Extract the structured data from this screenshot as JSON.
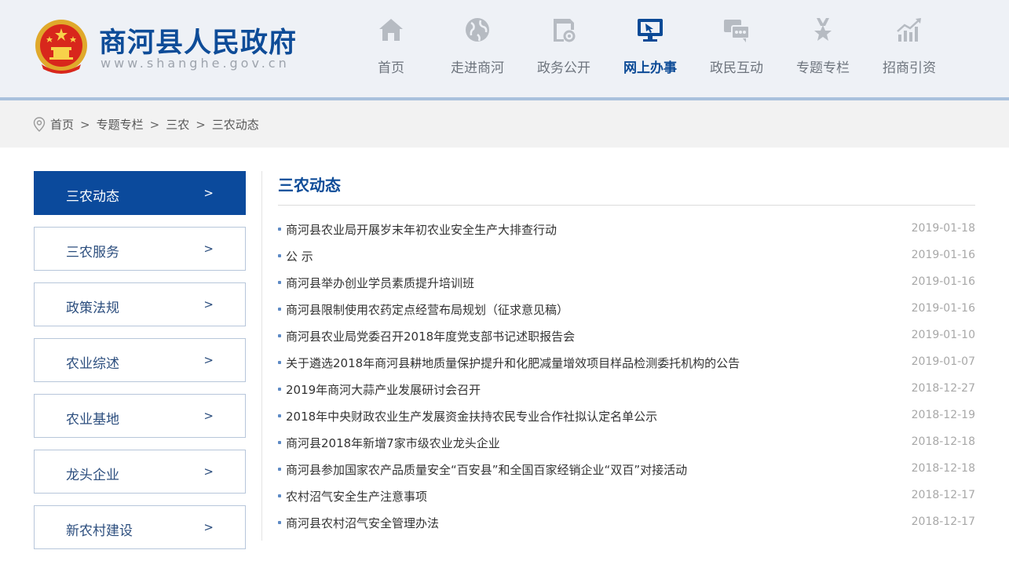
{
  "header": {
    "title": "商河县人民政府",
    "url": "www.shanghe.gov.cn",
    "emblem_icon": "national-emblem-icon"
  },
  "nav": {
    "items": [
      {
        "label": "首页",
        "icon": "home-icon"
      },
      {
        "label": "走进商河",
        "icon": "globe-icon"
      },
      {
        "label": "政务公开",
        "icon": "document-gear-icon"
      },
      {
        "label": "网上办事",
        "icon": "monitor-icon",
        "active": true
      },
      {
        "label": "政民互动",
        "icon": "chat-icon"
      },
      {
        "label": "专题专栏",
        "icon": "medal-icon"
      },
      {
        "label": "招商引资",
        "icon": "chart-growth-icon"
      }
    ]
  },
  "breadcrumb": {
    "items": [
      "首页",
      "专题专栏",
      "三农",
      "三农动态"
    ],
    "separator": ">"
  },
  "sidebar": {
    "arrow": ">",
    "items": [
      {
        "label": "三农动态",
        "active": true
      },
      {
        "label": "三农服务"
      },
      {
        "label": "政策法规"
      },
      {
        "label": "农业综述"
      },
      {
        "label": "农业基地"
      },
      {
        "label": "龙头企业"
      },
      {
        "label": "新农村建设"
      }
    ]
  },
  "content": {
    "title": "三农动态",
    "articles": [
      {
        "title": "商河县农业局开展岁末年初农业安全生产大排查行动",
        "date": "2019-01-18"
      },
      {
        "title": "公  示",
        "date": "2019-01-16"
      },
      {
        "title": "商河县举办创业学员素质提升培训班",
        "date": "2019-01-16"
      },
      {
        "title": "商河县限制使用农药定点经营布局规划（征求意见稿）",
        "date": "2019-01-16"
      },
      {
        "title": "商河县农业局党委召开2018年度党支部书记述职报告会",
        "date": "2019-01-10"
      },
      {
        "title": "关于遴选2018年商河县耕地质量保护提升和化肥减量增效项目样品检测委托机构的公告",
        "date": "2019-01-07"
      },
      {
        "title": "2019年商河大蒜产业发展研讨会召开",
        "date": "2018-12-27"
      },
      {
        "title": "2018年中央财政农业生产发展资金扶持农民专业合作社拟认定名单公示",
        "date": "2018-12-19"
      },
      {
        "title": "商河县2018年新增7家市级农业龙头企业",
        "date": "2018-12-18"
      },
      {
        "title": "商河县参加国家农产品质量安全“百安县”和全国百家经销企业“双百”对接活动",
        "date": "2018-12-18"
      },
      {
        "title": "农村沼气安全生产注意事项",
        "date": "2018-12-17"
      },
      {
        "title": "商河县农村沼气安全管理办法",
        "date": "2018-12-17"
      }
    ]
  },
  "colors": {
    "brand": "#0e4c98",
    "active_bg": "#0b4a9c",
    "header_bg": "#eef1f6",
    "icon_gray": "#b6bbc2"
  }
}
